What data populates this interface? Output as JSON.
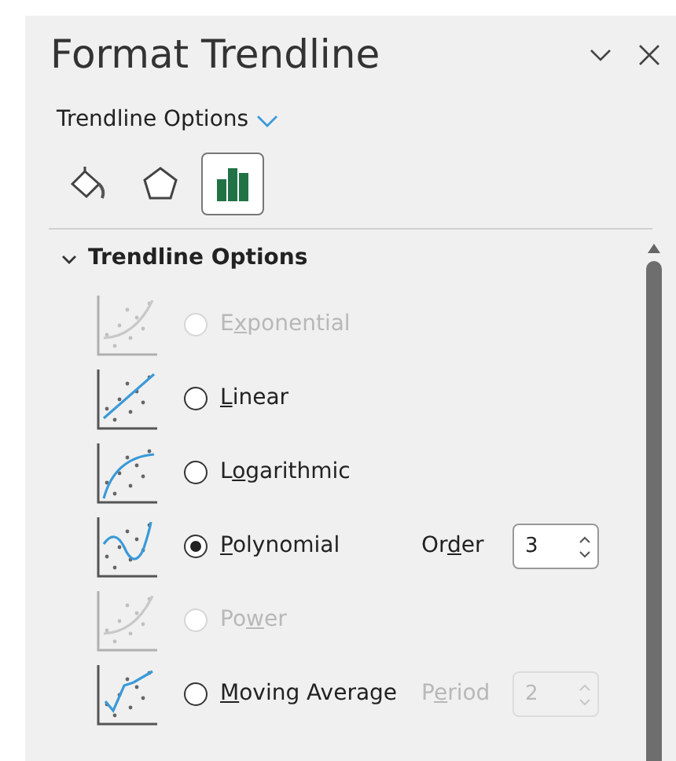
{
  "pane": {
    "title": "Format Trendline",
    "subtitle": "Trendline Options",
    "tabs": [
      {
        "kind": "fill",
        "selected": false
      },
      {
        "kind": "effects",
        "selected": false
      },
      {
        "kind": "options",
        "selected": true
      }
    ]
  },
  "section": {
    "title": "Trendline Options",
    "expanded": true,
    "options": [
      {
        "kind": "exponential",
        "label": {
          "before": "E",
          "key": "x",
          "after": "ponential"
        },
        "disabled": true,
        "selected": false
      },
      {
        "kind": "linear",
        "label": {
          "key": "L",
          "after": "inear"
        },
        "disabled": false,
        "selected": false
      },
      {
        "kind": "logarithmic",
        "label": {
          "before": "L",
          "key": "o",
          "after": "garithmic"
        },
        "disabled": false,
        "selected": false
      },
      {
        "kind": "polynomial",
        "label": {
          "key": "P",
          "after": "olynomial"
        },
        "disabled": false,
        "selected": true,
        "param": {
          "label": {
            "before": "Or",
            "key": "d",
            "after": "er"
          },
          "value": "3",
          "disabled": false
        }
      },
      {
        "kind": "power",
        "label": {
          "before": "Po",
          "key": "w",
          "after": "er"
        },
        "disabled": true,
        "selected": false
      },
      {
        "kind": "moving",
        "label": {
          "key": "M",
          "after": "oving Average"
        },
        "disabled": false,
        "selected": false,
        "param": {
          "label": {
            "before": "P",
            "key": "e",
            "after": "riod"
          },
          "value": "2",
          "disabled": true
        }
      }
    ]
  }
}
